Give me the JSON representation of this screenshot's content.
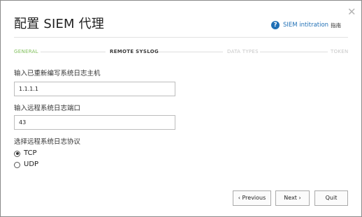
{
  "dialog": {
    "title": "配置 SIEM 代理",
    "close_glyph": "✕",
    "help": {
      "icon": "help-circle-icon",
      "link_text": "SIEM intitration",
      "suffix": "指南"
    }
  },
  "wizard": {
    "steps": [
      {
        "label": "GENERAL",
        "state": "completed"
      },
      {
        "label": "REMOTE SYSLOG",
        "state": "current"
      },
      {
        "label": "DATA TYPES",
        "state": "upcoming"
      },
      {
        "label": "TOKEN",
        "state": "upcoming"
      }
    ]
  },
  "form": {
    "host_label": "输入已重新编写系统日志主机",
    "host_value": "1.1.1.1",
    "port_label": "输入远程系统日志端口",
    "port_value": "43",
    "protocol_label": "选择远程系统日志协议",
    "protocols": [
      {
        "label": "TCP",
        "selected": true
      },
      {
        "label": "UDP",
        "selected": false
      }
    ]
  },
  "buttons": {
    "previous": "Previous",
    "next": "Next",
    "quit": "Quit"
  },
  "colors": {
    "accent": "#1f6fb5",
    "step_completed": "#7fbf5a",
    "step_upcoming": "#c7c7c7"
  }
}
